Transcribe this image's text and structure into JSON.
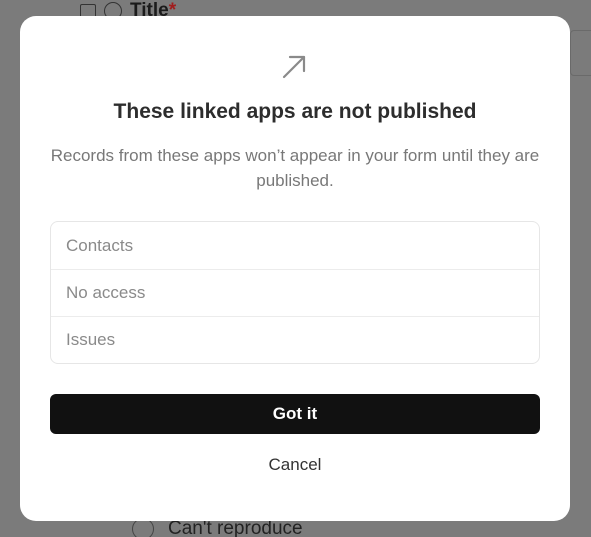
{
  "background": {
    "header_field_label": "Title",
    "required_marker": "*",
    "option_label": "Can't reproduce",
    "overlay_color": "#7b7b7b",
    "icons": [
      "folder-icon",
      "field-type-icon",
      "radio-icon"
    ]
  },
  "dialog": {
    "icon": "arrow-up-right-icon",
    "title": "These linked apps are not published",
    "description": "Records from these apps won’t appear in your form until they are published.",
    "apps": [
      {
        "label": "Contacts"
      },
      {
        "label": "No access"
      },
      {
        "label": "Issues"
      }
    ],
    "primary_button": "Got it",
    "secondary_button": "Cancel",
    "colors": {
      "primary_button_bg": "#111111",
      "primary_button_text": "#ffffff",
      "muted_text": "#787878"
    }
  }
}
